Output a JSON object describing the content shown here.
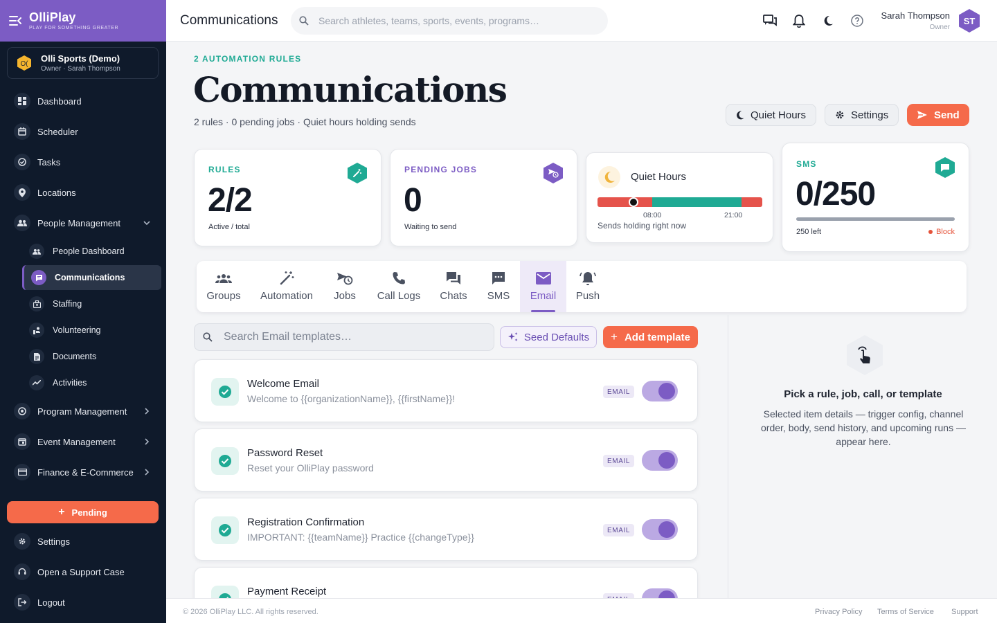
{
  "brand": {
    "name": "OlliPlay",
    "tagline": "PLAY FOR SOMETHING GREATER"
  },
  "org": {
    "name": "Olli Sports (Demo)",
    "subtitle": "Owner · Sarah Thompson",
    "logo_text": "O("
  },
  "sidebar": {
    "items": [
      {
        "label": "Dashboard",
        "icon": "dashboard-icon"
      },
      {
        "label": "Scheduler",
        "icon": "calendar-icon"
      },
      {
        "label": "Tasks",
        "icon": "check-circle-icon"
      },
      {
        "label": "Locations",
        "icon": "pin-icon"
      },
      {
        "label": "People Management",
        "icon": "people-icon"
      },
      {
        "label": "Program Management",
        "icon": "ball-icon"
      },
      {
        "label": "Event Management",
        "icon": "event-icon"
      },
      {
        "label": "Finance & E-Commerce",
        "icon": "card-icon"
      }
    ],
    "sub_items": [
      {
        "label": "People Dashboard",
        "icon": "people-icon"
      },
      {
        "label": "Communications",
        "icon": "chat-icon"
      },
      {
        "label": "Staffing",
        "icon": "badge-icon"
      },
      {
        "label": "Volunteering",
        "icon": "volunteer-icon"
      },
      {
        "label": "Documents",
        "icon": "document-icon"
      },
      {
        "label": "Activities",
        "icon": "trend-icon"
      }
    ],
    "pending_label": "Pending",
    "bottom_items": [
      {
        "label": "Settings",
        "icon": "gear-icon"
      },
      {
        "label": "Open a Support Case",
        "icon": "support-icon"
      },
      {
        "label": "Logout",
        "icon": "logout-icon"
      }
    ]
  },
  "topbar": {
    "title": "Communications",
    "search_placeholder": "Search athletes, teams, sports, events, programs…",
    "user_name": "Sarah Thompson",
    "user_role": "Owner",
    "avatar_initials": "ST"
  },
  "header": {
    "eyebrow": "2 AUTOMATION RULES",
    "title": "Communications",
    "subtitle": "2 rules · 0 pending jobs · Quiet hours holding sends",
    "quiet_hours_label": "Quiet Hours",
    "settings_label": "Settings",
    "send_label": "Send"
  },
  "stats": {
    "rules": {
      "label": "RULES",
      "value": "2/2",
      "note": "Active / total",
      "color": "#1faa94"
    },
    "pending": {
      "label": "PENDING JOBS",
      "value": "0",
      "note": "Waiting to send",
      "color": "#7c5cc4"
    },
    "quiet": {
      "title": "Quiet Hours",
      "start": "08:00",
      "end": "21:00",
      "note": "Sends holding right now",
      "start_fraction": 0.333,
      "end_fraction": 0.875,
      "now_fraction": 0.22,
      "active_color": "#1faa94",
      "quiet_color": "#e5534b"
    },
    "sms": {
      "label": "SMS",
      "value": "0/250",
      "used": 0,
      "limit": 250,
      "left_label": "250 left",
      "block_label": "Block",
      "color": "#1faa94"
    }
  },
  "tabs": [
    {
      "label": "Groups",
      "icon": "groups-icon"
    },
    {
      "label": "Automation",
      "icon": "wand-icon"
    },
    {
      "label": "Jobs",
      "icon": "jobs-icon"
    },
    {
      "label": "Call Logs",
      "icon": "phone-icon"
    },
    {
      "label": "Chats",
      "icon": "chats-icon"
    },
    {
      "label": "SMS",
      "icon": "sms-icon"
    },
    {
      "label": "Email",
      "icon": "mail-icon",
      "active": true
    },
    {
      "label": "Push",
      "icon": "bell-ring-icon"
    }
  ],
  "templates": {
    "search_placeholder": "Search Email templates…",
    "seed_label": "Seed Defaults",
    "add_label": "Add template",
    "items": [
      {
        "name": "Welcome Email",
        "subject": "Welcome to {{organizationName}}, {{firstName}}!",
        "badge": "EMAIL",
        "enabled": true
      },
      {
        "name": "Password Reset",
        "subject": "Reset your OlliPlay password",
        "badge": "EMAIL",
        "enabled": true
      },
      {
        "name": "Registration Confirmation",
        "subject": "IMPORTANT: {{teamName}} Practice {{changeType}}",
        "badge": "EMAIL",
        "enabled": true
      },
      {
        "name": "Payment Receipt",
        "subject": "",
        "badge": "EMAIL",
        "enabled": true
      }
    ]
  },
  "detail": {
    "title": "Pick a rule, job, call, or template",
    "description": "Selected item details — trigger config, channel order, body, send history, and upcoming runs — appear here."
  },
  "footer": {
    "copyright": "© 2026 OlliPlay LLC. All rights reserved.",
    "links": [
      "Privacy Policy",
      "Terms of Service",
      "Support"
    ]
  },
  "colors": {
    "brand": "#7c5cc4",
    "accent": "#f56a4a",
    "teal": "#1faa94",
    "sidebar_bg": "#0f1a2b"
  }
}
